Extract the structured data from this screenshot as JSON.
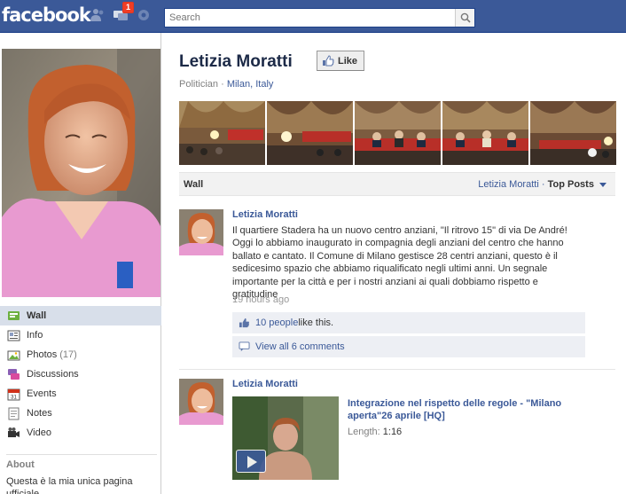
{
  "topbar": {
    "logo": "facebook",
    "notification_count": "1",
    "search_placeholder": "Search"
  },
  "sidebar": {
    "items": [
      {
        "label": "Wall",
        "icon": "wall-icon",
        "active": true
      },
      {
        "label": "Info",
        "icon": "info-icon"
      },
      {
        "label": "Photos",
        "count": "(17)",
        "icon": "photos-icon"
      },
      {
        "label": "Discussions",
        "icon": "discussions-icon"
      },
      {
        "label": "Events",
        "icon": "calendar-icon"
      },
      {
        "label": "Notes",
        "icon": "notes-icon"
      },
      {
        "label": "Video",
        "icon": "video-camera-icon"
      }
    ],
    "about_heading": "About",
    "about_text": "Questa è la mia unica pagina ufficiale"
  },
  "profile": {
    "name": "Letizia Moratti",
    "like_label": "Like",
    "category": "Politician",
    "location": "Milan, Italy"
  },
  "wall": {
    "title": "Wall",
    "filter_name": "Letizia Moratti",
    "filter_mode": "Top Posts"
  },
  "posts": [
    {
      "author": "Letizia Moratti",
      "text": "Il quartiere Stadera ha un nuovo centro anziani, \"Il ritrovo 15\" di via De André! Oggi lo abbiamo inaugurato in compagnia degli anziani del centro che hanno ballato e cantato. Il Comune di Milano gestisce 28 centri anziani, questo è il sedicesimo spazio che abbiamo riqualificato negli ultimi anni. Un segnale importante per la città e per i nostri anziani ai quali dobbiamo rispetto e gratitudine",
      "time": "19 hours ago",
      "likes_link": "10 people",
      "likes_suffix": " like this.",
      "comments_link": "View all 6 comments"
    },
    {
      "author": "Letizia Moratti",
      "video_title": "Integrazione nel rispetto delle regole - \"Milano aperta\"26 aprile [HQ]",
      "length_label": "Length:",
      "length_value": "1:16"
    }
  ],
  "colors": {
    "brand": "#3b5998",
    "active_nav": "#d8dfea",
    "ufi_bg": "#edeff4",
    "badge": "#f03d25"
  }
}
